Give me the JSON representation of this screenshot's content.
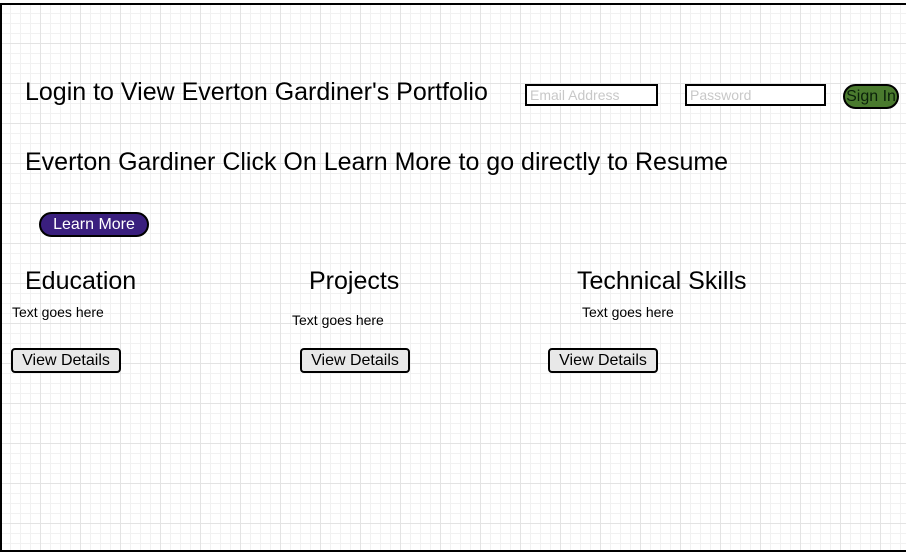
{
  "header": {
    "login_title": "Login to View Everton Gardiner's Portfolio",
    "email_placeholder": "Email Address",
    "password_placeholder": "Password",
    "signin_label": "Sign In"
  },
  "hero": {
    "headline": "Everton Gardiner Click On Learn More to go directly to Resume",
    "learn_more_label": "Learn More"
  },
  "sections": [
    {
      "title": "Education",
      "text": "Text goes here",
      "button_label": "View Details"
    },
    {
      "title": "Projects",
      "text": "Text goes here",
      "button_label": "View Details"
    },
    {
      "title": "Technical Skills",
      "text": "Text goes here",
      "button_label": "View Details"
    }
  ],
  "colors": {
    "signin_bg": "#4a7a2e",
    "learn_more_bg": "#3a1f7e",
    "details_bg": "#e8e8e8"
  }
}
